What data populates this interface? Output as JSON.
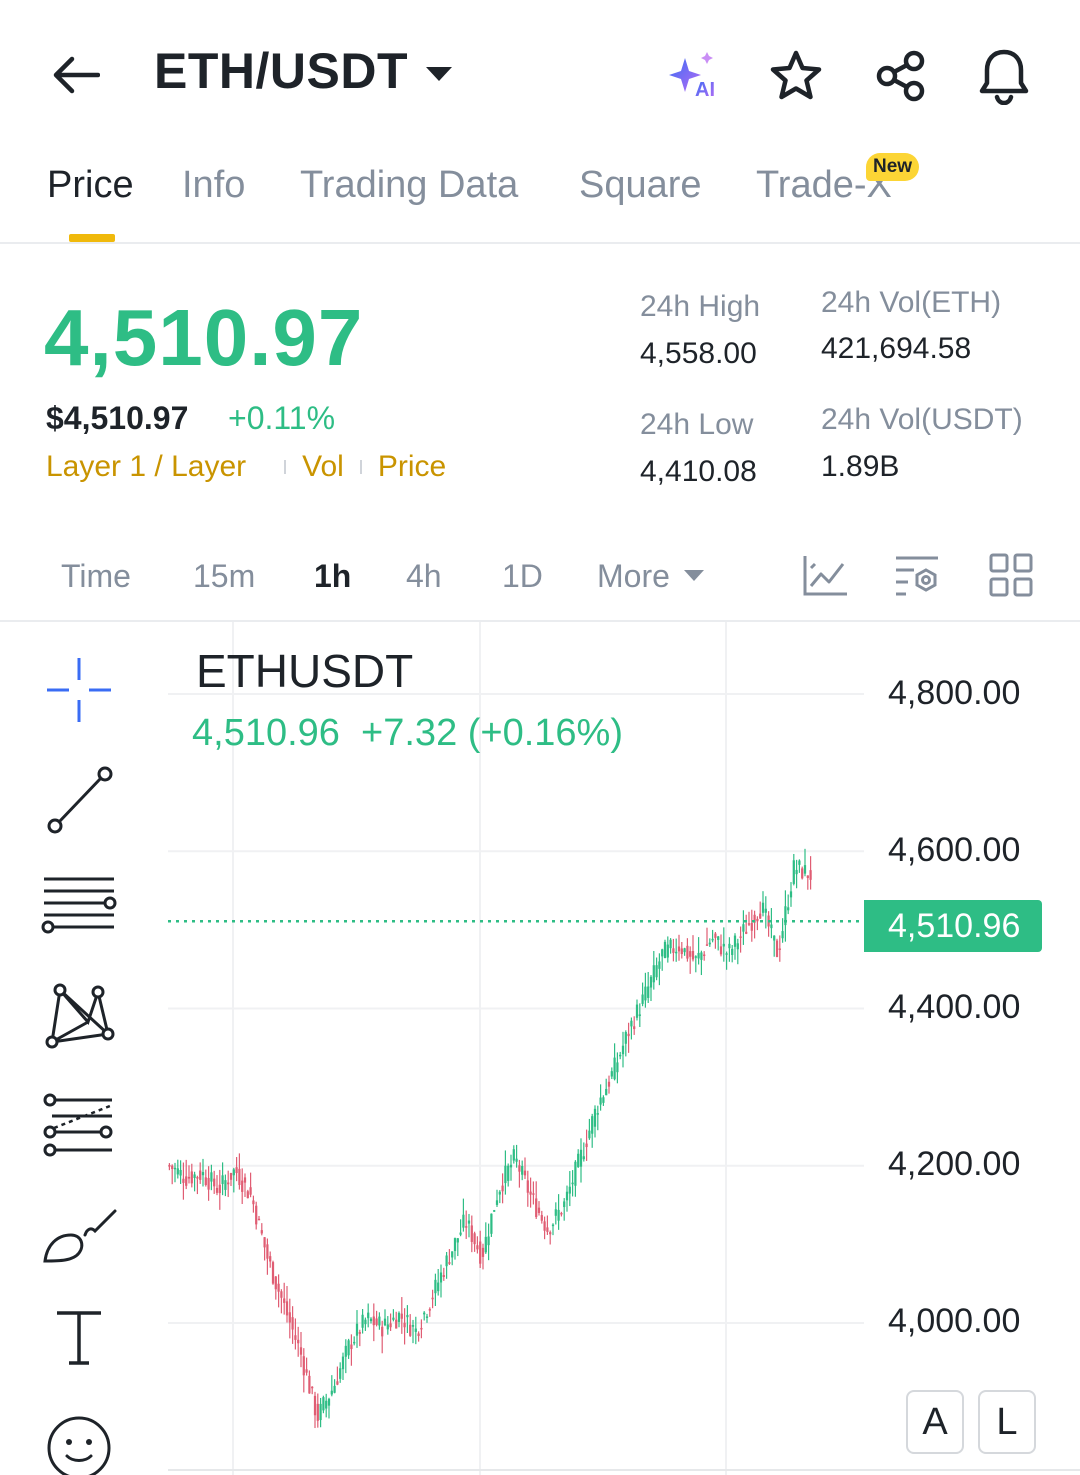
{
  "header": {
    "pair": "ETH/USDT",
    "ai_label": "AI"
  },
  "tabs": [
    {
      "label": "Price"
    },
    {
      "label": "Info"
    },
    {
      "label": "Trading Data"
    },
    {
      "label": "Square"
    },
    {
      "label": "Trade-X",
      "badge": "New"
    }
  ],
  "ticker": {
    "last_price": "4,510.97",
    "usd_price": "$4,510.97",
    "change_pct": "+0.11%",
    "tags": [
      "Layer 1 / Layer",
      "Vol",
      "Price"
    ],
    "stats": {
      "high_label": "24h High",
      "high_value": "4,558.00",
      "low_label": "24h Low",
      "low_value": "4,410.08",
      "vol_eth_label": "24h Vol(ETH)",
      "vol_eth_value": "421,694.58",
      "vol_usdt_label": "24h Vol(USDT)",
      "vol_usdt_value": "1.89B"
    }
  },
  "intervals": {
    "items": [
      "Time",
      "15m",
      "1h",
      "4h",
      "1D"
    ],
    "active": "1h",
    "more_label": "More"
  },
  "chart": {
    "symbol": "ETHUSDT",
    "last": "4,510.96",
    "change": "+7.32 (+0.16%)",
    "y_ticks": [
      "4,800.00",
      "4,600.00",
      "4,400.00",
      "4,200.00",
      "4,000.00"
    ],
    "last_price_tag": "4,510.96",
    "scale_buttons": [
      "A",
      "L"
    ],
    "colors": {
      "up": "#2ebd85",
      "down": "#e05d73",
      "accent": "#f0b90b"
    }
  },
  "chart_data": {
    "type": "line",
    "title": "ETHUSDT",
    "x": [
      0,
      4,
      8,
      12,
      16,
      20,
      24,
      28,
      32,
      36,
      40,
      44,
      48,
      52,
      56,
      60,
      64,
      68,
      72,
      76,
      80,
      84,
      88,
      92,
      96,
      100,
      104,
      108,
      112,
      116,
      120,
      124,
      128,
      132,
      136,
      140,
      144,
      148,
      152,
      156
    ],
    "series": [
      {
        "values": [
          4200,
          4185,
          4190,
          4170,
          4195,
          4160,
          4080,
          4020,
          3960,
          3880,
          3920,
          3975,
          4005,
          3995,
          4010,
          3990,
          4035,
          4085,
          4130,
          4085,
          4170,
          4210,
          4160,
          4120,
          4150,
          4210,
          4275,
          4320,
          4375,
          4420,
          4470,
          4480,
          4460,
          4490,
          4470,
          4500,
          4530,
          4470,
          4580,
          4570
        ]
      }
    ],
    "ylim": [
      3850,
      4850
    ],
    "y_ticks": [
      4000,
      4200,
      4400,
      4600,
      4800
    ],
    "last_price": 4510.96
  }
}
